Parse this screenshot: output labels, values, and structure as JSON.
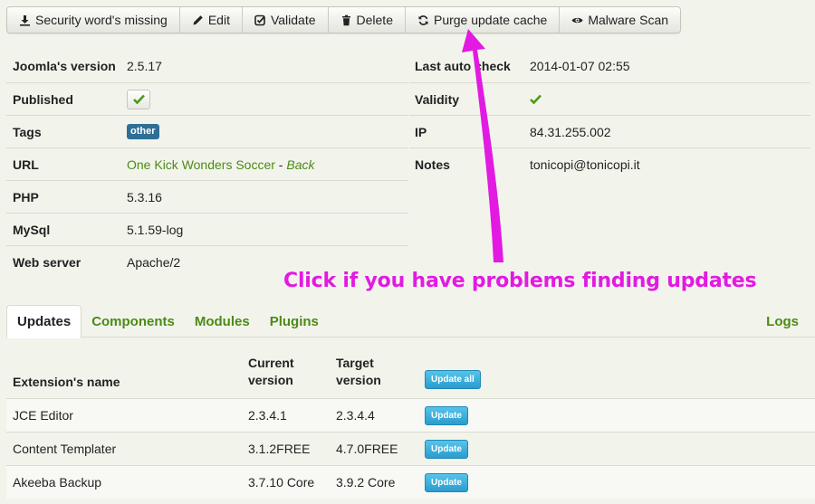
{
  "toolbar": {
    "buttons": [
      {
        "label": "Security word's missing",
        "icon": "download-icon"
      },
      {
        "label": "Edit",
        "icon": "pencil-icon"
      },
      {
        "label": "Validate",
        "icon": "check-square-icon"
      },
      {
        "label": "Delete",
        "icon": "trash-icon"
      },
      {
        "label": "Purge update cache",
        "icon": "refresh-icon"
      },
      {
        "label": "Malware Scan",
        "icon": "eye-icon"
      }
    ]
  },
  "site_info": {
    "joomla_version": {
      "label": "Joomla's version",
      "value": "2.5.17"
    },
    "published": {
      "label": "Published",
      "checked": true
    },
    "tags": {
      "label": "Tags",
      "badge": "other"
    },
    "url": {
      "label": "URL",
      "site_name": "One Kick Wonders Soccer",
      "separator": " - ",
      "back_link": "Back"
    },
    "php": {
      "label": "PHP",
      "value": "5.3.16"
    },
    "mysql": {
      "label": "MySql",
      "value": "5.1.59-log"
    },
    "web_server": {
      "label": "Web server",
      "value": "Apache/2"
    },
    "last_auto_check": {
      "label": "Last auto check",
      "value": "2014-01-07 02:55"
    },
    "validity": {
      "label": "Validity",
      "valid": true
    },
    "ip": {
      "label": "IP",
      "value": "84.31.255.002"
    },
    "notes": {
      "label": "Notes",
      "value": "tonicopi@tonicopi.it"
    }
  },
  "annotation": {
    "text": "Click if you have problems finding updates",
    "color": "#e21ae2"
  },
  "tabs": {
    "items": [
      "Updates",
      "Components",
      "Modules",
      "Plugins"
    ],
    "active": "Updates",
    "logs": "Logs"
  },
  "updates_table": {
    "headers": {
      "name": "Extension's name",
      "current_1": "Current",
      "current_2": "version",
      "target_1": "Target",
      "target_2": "version",
      "update_all": "Update all"
    },
    "rows": [
      {
        "name": "JCE Editor",
        "current": "2.3.4.1",
        "target": "2.3.4.4",
        "action": "Update"
      },
      {
        "name": "Content Templater",
        "current": "3.1.2FREE",
        "target": "4.7.0FREE",
        "action": "Update"
      },
      {
        "name": "Akeeba Backup",
        "current": "3.7.10 Core",
        "target": "3.9.2 Core",
        "action": "Update"
      }
    ]
  },
  "colors": {
    "link_green": "#4c8a16",
    "badge_blue": "#2f6f95",
    "button_blue": "#2a9ccd",
    "annotation_magenta": "#e21ae2"
  }
}
